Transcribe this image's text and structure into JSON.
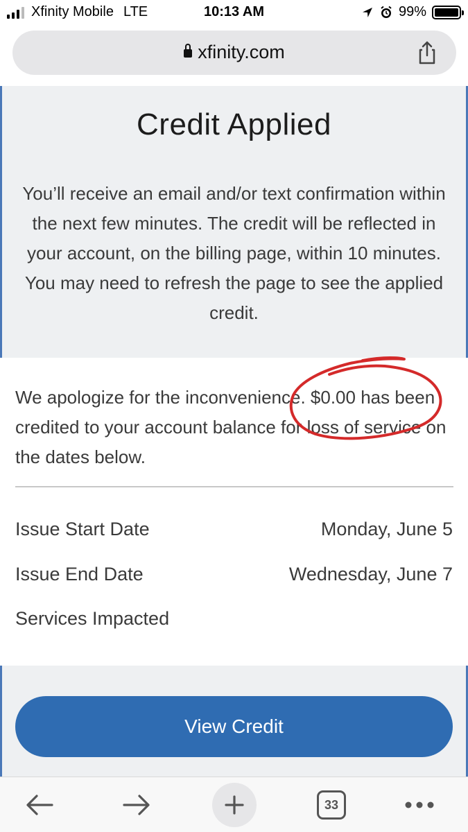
{
  "status_bar": {
    "carrier": "Xfinity Mobile",
    "network": "LTE",
    "time": "10:13 AM",
    "battery_text": "99%",
    "battery_level": 0.99,
    "icons": [
      "signal-icon",
      "location-icon",
      "alarm-icon",
      "battery-icon"
    ]
  },
  "browser": {
    "url": "xfinity.com",
    "share_icon": "share-icon",
    "lock_icon": "lock-icon"
  },
  "page": {
    "title": "Credit Applied",
    "intro": "You’ll receive an email and/or text confirmation within the next few minutes. The credit will be reflected in your account, on the billing page, within 10 minutes. You may need to refresh the page to see the applied credit.",
    "apology": "We apologize for the inconvenience. $0.00 has been credited to your account balance for loss of service on the dates below.",
    "details": [
      {
        "label": "Issue Start Date",
        "value": "Monday, June 5"
      },
      {
        "label": "Issue End Date",
        "value": "Wednesday, June 7"
      },
      {
        "label": "Services Impacted",
        "value": ""
      }
    ],
    "button_label": "View Credit"
  },
  "toolbar": {
    "tab_count": "33",
    "icons": [
      "back-arrow-icon",
      "forward-arrow-icon",
      "plus-icon",
      "tabs-icon",
      "more-icon"
    ]
  },
  "colors": {
    "accent": "#2f6cb2",
    "annotation": "#d42a2a",
    "panel_background": "#eef0f2"
  }
}
